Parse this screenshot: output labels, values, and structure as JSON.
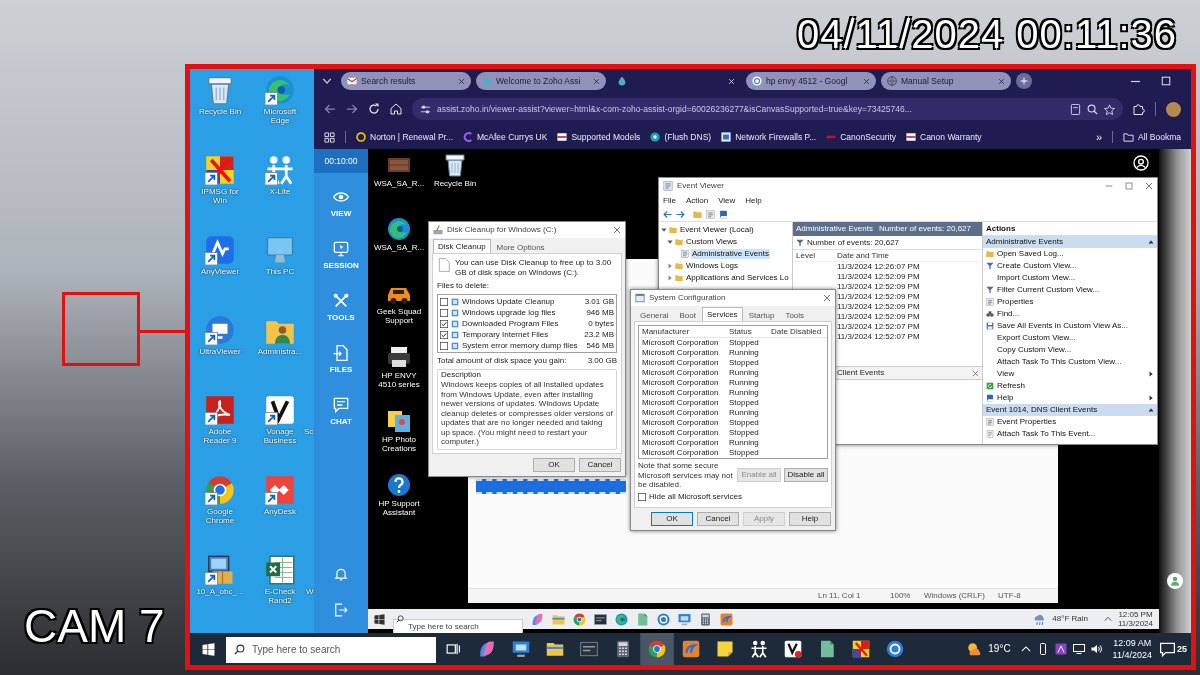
{
  "overlay": {
    "timestamp": "04/11/2024 00:11:36",
    "camera": "CAM 7"
  },
  "desktop": {
    "icons": [
      {
        "label": "Recycle Bin",
        "kind": "recycle_bin",
        "shortcut": false
      },
      {
        "label": "Microsoft Edge",
        "kind": "edge",
        "shortcut": true
      },
      {
        "label": "IPMSG for Win",
        "kind": "ipmsg",
        "shortcut": true
      },
      {
        "label": "X-Lite",
        "kind": "xlite",
        "shortcut": true
      },
      {
        "label": "AnyViewer",
        "kind": "anyviewer",
        "shortcut": true
      },
      {
        "label": "This PC",
        "kind": "pc",
        "shortcut": false
      },
      {
        "label": "UltraViewer",
        "kind": "ultraviewer",
        "shortcut": true
      },
      {
        "label": "Administra...",
        "kind": "user_folder",
        "shortcut": false
      },
      {
        "label": "Adobe Reader 9",
        "kind": "adobe",
        "shortcut": true
      },
      {
        "label": "Vonage Business",
        "kind": "vonage",
        "shortcut": true
      },
      {
        "label": "Google Chrome",
        "kind": "chrome",
        "shortcut": true
      },
      {
        "label": "AnyDesk",
        "kind": "anydesk",
        "shortcut": true
      },
      {
        "label": "10_A_obc_...",
        "kind": "installer",
        "shortcut": true
      },
      {
        "label": "E-Check Rand2",
        "kind": "excel",
        "shortcut": false
      }
    ],
    "partial_labels": [
      "Sc",
      "W"
    ]
  },
  "browser": {
    "tabs": [
      {
        "title": "Search results",
        "kind": "mail",
        "selected": false
      },
      {
        "title": "Welcome to Zoho Assi",
        "kind": "zoho",
        "selected": false
      },
      {
        "kind": "zoho",
        "selected": true
      },
      {
        "title": "hp envy 4512 - Googl",
        "kind": "google",
        "selected": false
      },
      {
        "title": "Manual Setup",
        "kind": "globe",
        "selected": false
      }
    ],
    "address": "assist.zoho.in/viewer-assist?viewer=html&x-com-zoho-assist-orgid=60026236277&isCanvasSupported=true&key=73425746...",
    "bookmarks": [
      {
        "label": "Norton | Renewal Pr...",
        "kind": "ring"
      },
      {
        "label": "McAfee Currys UK",
        "kind": "arc"
      },
      {
        "label": "Supported Models",
        "kind": "page"
      },
      {
        "label": "(Flush DNS)",
        "kind": "circle"
      },
      {
        "label": "Network Firewalls P...",
        "kind": "square"
      },
      {
        "label": "CanonSecurity",
        "kind": "bar"
      },
      {
        "label": "Canon Warranty",
        "kind": "page"
      }
    ],
    "more": "»",
    "all_bookmarks": "All Bookma"
  },
  "assist_panel": {
    "timer": "00:10:00",
    "items": [
      {
        "label": "VIEW",
        "kind": "eye"
      },
      {
        "label": "SESSION",
        "kind": "session"
      },
      {
        "label": "TOOLS",
        "kind": "tools"
      },
      {
        "label": "FILES",
        "kind": "files"
      },
      {
        "label": "CHAT",
        "kind": "chat"
      }
    ]
  },
  "remote": {
    "desktop_icons": [
      [
        {
          "label": "WSA_SA_R...",
          "kind": "box"
        },
        {
          "label": "Recycle Bin",
          "kind": "recycle_bin"
        }
      ],
      [
        {
          "label": "WSA_SA_R...",
          "kind": "edge"
        }
      ],
      [
        {
          "label": "Geek Squad Support",
          "kind": "car"
        }
      ],
      [
        {
          "label": "HP ENVY 4510 series",
          "kind": "printer"
        }
      ],
      [
        {
          "label": "HP Photo Creations",
          "kind": "photos"
        }
      ],
      [
        {
          "label": "HP Support Assistant",
          "kind": "help"
        }
      ]
    ],
    "disk_cleanup": {
      "title": "Disk Cleanup for Windows (C:)",
      "tabs": [
        {
          "label": "Disk Cleanup",
          "selected": true
        },
        {
          "label": "More Options",
          "selected": false
        }
      ],
      "intro": "You can use Disk Cleanup to free up to 3.00 GB of disk space on Windows (C:).",
      "files_label": "Files to delete:",
      "files": [
        {
          "name": "Windows Update Cleanup",
          "size": "3.01 GB",
          "checked": false
        },
        {
          "name": "Windows upgrade log files",
          "size": "946 MB",
          "checked": false
        },
        {
          "name": "Downloaded Program Files",
          "size": "0 bytes",
          "checked": true
        },
        {
          "name": "Temporary Internet Files",
          "size": "23.2 MB",
          "checked": true
        },
        {
          "name": "System error memory dump files",
          "size": "546 MB",
          "checked": false
        }
      ],
      "total_label": "Total amount of disk space you gain:",
      "total": "3.00 GB",
      "description_label": "Description",
      "description": "Windows keeps copies of all installed updates from Windows Update, even after installing newer versions of updates. Windows Update cleanup deletes or compresses older versions of updates that are no longer needed and taking up space. (You might need to restart your computer.)",
      "buttons": [
        "OK",
        "Cancel"
      ]
    },
    "system_configuration": {
      "title": "System Configuration",
      "tabs": [
        {
          "label": "General",
          "selected": false
        },
        {
          "label": "Boot",
          "selected": false
        },
        {
          "label": "Services",
          "selected": true
        },
        {
          "label": "Startup",
          "selected": false
        },
        {
          "label": "Tools",
          "selected": false
        }
      ],
      "columns": [
        "Manufacturer",
        "Status",
        "Date Disabled"
      ],
      "rows": [
        {
          "manufacturer": "Microsoft Corporation",
          "status": "Stopped"
        },
        {
          "manufacturer": "Microsoft Corporation",
          "status": "Running"
        },
        {
          "manufacturer": "Microsoft Corporation",
          "status": "Stopped"
        },
        {
          "manufacturer": "Microsoft Corporation",
          "status": "Running"
        },
        {
          "manufacturer": "Microsoft Corporation",
          "status": "Running"
        },
        {
          "manufacturer": "Microsoft Corporation",
          "status": "Running"
        },
        {
          "manufacturer": "Microsoft Corporation",
          "status": "Stopped"
        },
        {
          "manufacturer": "Microsoft Corporation",
          "status": "Running"
        },
        {
          "manufacturer": "Microsoft Corporation",
          "status": "Stopped"
        },
        {
          "manufacturer": "Microsoft Corporation",
          "status": "Stopped"
        },
        {
          "manufacturer": "Microsoft Corporation",
          "status": "Running"
        },
        {
          "manufacturer": "Microsoft Corporation",
          "status": "Stopped"
        }
      ],
      "note": "Note that some secure Microsoft services may not be disabled.",
      "enable_all": {
        "label": "Enable all",
        "disabled": true
      },
      "disable_all": {
        "label": "Disable all",
        "disabled": false
      },
      "hide_microsoft": {
        "label": "Hide all Microsoft services",
        "checked": false
      },
      "buttons": [
        {
          "label": "OK",
          "kind": "default"
        },
        {
          "label": "Cancel",
          "kind": "normal"
        },
        {
          "label": "Apply",
          "kind": "disabled"
        },
        {
          "label": "Help",
          "kind": "normal"
        }
      ]
    },
    "event_viewer": {
      "title": "Event Viewer",
      "menu": [
        "File",
        "Action",
        "View",
        "Help"
      ],
      "tree": [
        {
          "label": "Event Viewer (Local)",
          "expanded": true,
          "selected": false,
          "children": [
            {
              "label": "Custom Views",
              "expanded": true,
              "selected": false,
              "children": [
                {
                  "label": "Administrative Events",
                  "selected": true
                }
              ]
            },
            {
              "label": "Windows Logs",
              "expanded": false,
              "selected": false
            },
            {
              "label": "Applications and Services Lo",
              "expanded": false,
              "selected": false
            }
          ]
        }
      ],
      "pane_title": "Administrative Events",
      "event_count": "Number of events: 20,627",
      "filter": "Number of events: 20,627",
      "columns": [
        "Level",
        "Date and Time"
      ],
      "dates": [
        "11/3/2024 12:26:07 PM",
        "11/3/2024 12:52:09 PM",
        "11/3/2024 12:52:09 PM",
        "11/3/2024 12:52:09 PM",
        "11/3/2024 12:52:09 PM",
        "11/3/2024 12:52:09 PM",
        "11/3/2024 12:52:07 PM",
        "11/3/2024 12:52:07 PM"
      ],
      "detail_title": "Client Events",
      "actions_title": "Actions",
      "sections": [
        {
          "title": "Administrative Events",
          "items": [
            {
              "label": "Open Saved Log...",
              "kind": "folder",
              "submenu": false
            },
            {
              "label": "Create Custom View...",
              "kind": "funnel",
              "submenu": false
            },
            {
              "label": "Import Custom View...",
              "kind": "none",
              "submenu": false
            },
            {
              "label": "Filter Current Custom View...",
              "kind": "funnel",
              "submenu": false
            },
            {
              "label": "Properties",
              "kind": "properties",
              "submenu": false
            },
            {
              "label": "Find...",
              "kind": "find",
              "submenu": false
            },
            {
              "label": "Save All Events in Custom View As...",
              "kind": "save",
              "submenu": false
            },
            {
              "label": "Export Custom View...",
              "kind": "none",
              "submenu": false
            },
            {
              "label": "Copy Custom View...",
              "kind": "none",
              "submenu": false
            },
            {
              "label": "Attach Task To This Custom View...",
              "kind": "none",
              "submenu": false
            },
            {
              "label": "View",
              "kind": "none",
              "submenu": true
            },
            {
              "label": "Refresh",
              "kind": "refresh",
              "submenu": false
            },
            {
              "label": "Help",
              "kind": "help",
              "submenu": true
            }
          ]
        },
        {
          "title": "Event 1014, DNS Client Events",
          "items": [
            {
              "label": "Event Properties",
              "kind": "properties",
              "submenu": false
            },
            {
              "label": "Attach Task To This Event...",
              "kind": "task",
              "submenu": false
            }
          ]
        }
      ]
    },
    "notepad_status": [
      "Ln 11, Col 1",
      "100%",
      "Windows (CRLF)",
      "UTF-8"
    ],
    "taskbar": {
      "search_placeholder": "Type here to search",
      "weather": "48°F Rain",
      "time": "12:05 PM",
      "date": "11/3/2024"
    }
  },
  "taskbar": {
    "search_placeholder": "Type here to search",
    "apps": [
      {
        "kind": "copilot",
        "selected": false
      },
      {
        "kind": "remote_desktop",
        "selected": false
      },
      {
        "kind": "explorer",
        "selected": false
      },
      {
        "kind": "dark_app",
        "selected": false
      },
      {
        "kind": "calculator",
        "selected": false
      },
      {
        "kind": "chrome",
        "selected": true
      },
      {
        "kind": "assist",
        "selected": false
      },
      {
        "kind": "sticky",
        "selected": false
      },
      {
        "kind": "xlite",
        "selected": false
      },
      {
        "kind": "vonage_badge",
        "selected": false
      },
      {
        "kind": "green_app",
        "selected": false
      },
      {
        "kind": "ipmsg",
        "selected": false
      },
      {
        "kind": "blue_circle",
        "selected": false
      }
    ],
    "weather": "19°C",
    "time": "12:09 AM",
    "date": "11/4/2024",
    "notifications": "25"
  }
}
